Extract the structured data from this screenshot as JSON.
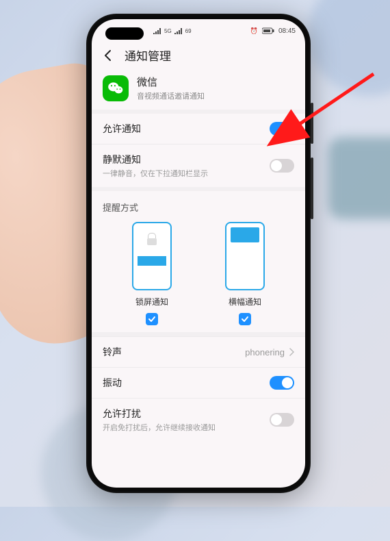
{
  "status": {
    "network": "5G",
    "battery_pct": "69",
    "alarm": "⏰",
    "battery_box": "75",
    "time": "08:45"
  },
  "header": {
    "title": "通知管理"
  },
  "app": {
    "name": "微信",
    "subtitle": "音视频通话邀请通知"
  },
  "rows": {
    "allow_notify": {
      "label": "允许通知"
    },
    "silent": {
      "label": "静默通知",
      "sub": "一律静音，仅在下拉通知栏显示"
    },
    "ringtone": {
      "label": "铃声",
      "value": "phonering"
    },
    "vibrate": {
      "label": "振动"
    },
    "dnd": {
      "label": "允许打扰",
      "sub": "开启免打扰后，允许继续接收通知"
    }
  },
  "reminder": {
    "section": "提醒方式",
    "lock": "锁屏通知",
    "banner": "横幅通知"
  },
  "toggles": {
    "allow_notify": true,
    "silent": false,
    "vibrate": true,
    "dnd": false
  },
  "checks": {
    "lock": true,
    "banner": true
  },
  "colors": {
    "accent": "#1e90ff",
    "app_icon": "#09bb07",
    "arrow": "#ff1a1a"
  }
}
